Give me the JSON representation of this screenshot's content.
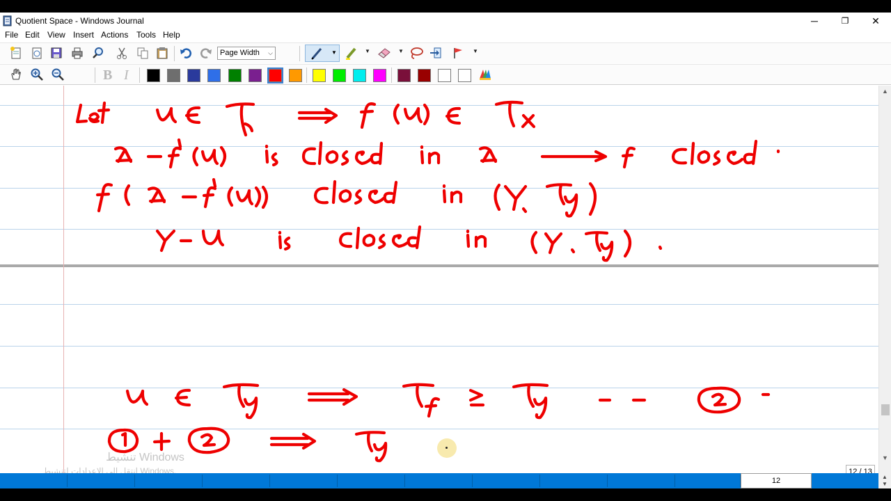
{
  "window": {
    "title": "Quotient Space - Windows Journal",
    "minimize": "─",
    "restore": "❐",
    "close": "✕"
  },
  "menu": [
    "File",
    "Edit",
    "View",
    "Insert",
    "Actions",
    "Tools",
    "Help"
  ],
  "toolbar": {
    "zoom_value": "Page Width",
    "bold": "B",
    "italic": "I",
    "colors": [
      "#000000",
      "#6e6e6e",
      "#2a3a9c",
      "#2f6fe8",
      "#008000",
      "#7a1f8f",
      "#ff0000",
      "#ff9900",
      "#ffff00",
      "#00ee00",
      "#00eeee",
      "#ff00ff",
      "#7a0f3a",
      "#990000",
      "#ffffff",
      "#ffffff"
    ],
    "selected_color": "#ff0000"
  },
  "status": {
    "page_count": "12 / 13",
    "current_page": "12"
  },
  "watermark": {
    "line1": "تنشيط Windows",
    "line2": "انتقل إلى الإعدادات لتنشيط Windows."
  },
  "ink_color": "#ee0000"
}
